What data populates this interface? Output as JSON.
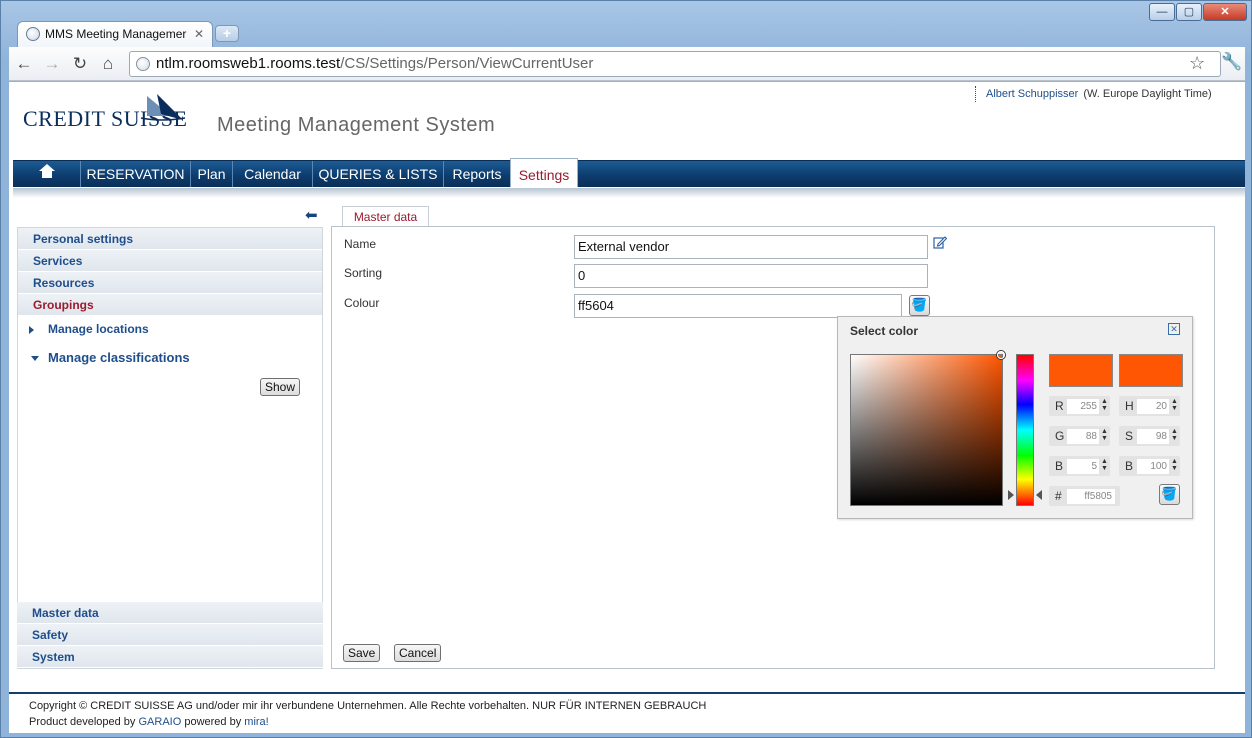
{
  "browser": {
    "tab_title": "MMS Meeting Managemer",
    "tab_close": "✕",
    "new_tab": "+",
    "url_host": "ntlm.roomsweb1.rooms.test",
    "url_path": "/CS/Settings/Person/ViewCurrentUser",
    "window_controls": {
      "minimize": "—",
      "maximize": "▢",
      "close": "✕"
    },
    "icons": {
      "back": "back-arrow-icon",
      "forward": "forward-arrow-icon",
      "reload": "reload-icon",
      "home": "home-icon",
      "star": "star-icon",
      "wrench": "wrench-icon"
    }
  },
  "header": {
    "user_name": "Albert Schuppisser",
    "timezone": "(W. Europe Daylight Time)",
    "logo_text": "CREDIT SUISSE",
    "app_title": "Meeting Management System"
  },
  "menu": {
    "items": [
      "RESERVATION",
      "Plan",
      "Calendar",
      "QUERIES & LISTS",
      "Reports",
      "Settings"
    ],
    "active": "Settings"
  },
  "sidebar": {
    "top_sections": [
      "Personal settings",
      "Services",
      "Resources",
      "Groupings"
    ],
    "active_section": "Groupings",
    "sub_items": [
      "Manage locations",
      "Manage classifications"
    ],
    "show_button": "Show",
    "bottom_sections": [
      "Master data",
      "Safety",
      "System"
    ]
  },
  "content": {
    "tab": "Master data",
    "fields": {
      "name_label": "Name",
      "name_value": "External vendor",
      "sorting_label": "Sorting",
      "sorting_value": "0",
      "colour_label": "Colour",
      "colour_value": "ff5604"
    },
    "save_button": "Save",
    "cancel_button": "Cancel"
  },
  "color_picker": {
    "title": "Select color",
    "close": "✕",
    "current_color": "#ff5805",
    "new_color": "#ff5604",
    "R_label": "R",
    "R": "255",
    "G_label": "G",
    "G": "88",
    "B_label": "B",
    "B": "5",
    "H_label": "H",
    "H": "20",
    "S_label": "S",
    "S": "98",
    "V_label": "B",
    "V": "100",
    "hex_label": "#",
    "hex": "ff5805"
  },
  "footer": {
    "copyright": "Copyright © CREDIT SUISSE AG und/oder mir ihr verbundene Unternehmen. Alle Rechte vorbehalten. NUR FÜR INTERNEN GEBRAUCH",
    "developed_prefix": "Product developed by",
    "developer": "GARAIO",
    "powered_prefix": "powered by",
    "powered": "mira!"
  },
  "colors": {
    "brand_navy": "#0d3d6e",
    "accent_red": "#9a1b2e",
    "link_blue": "#1f4e8c"
  }
}
